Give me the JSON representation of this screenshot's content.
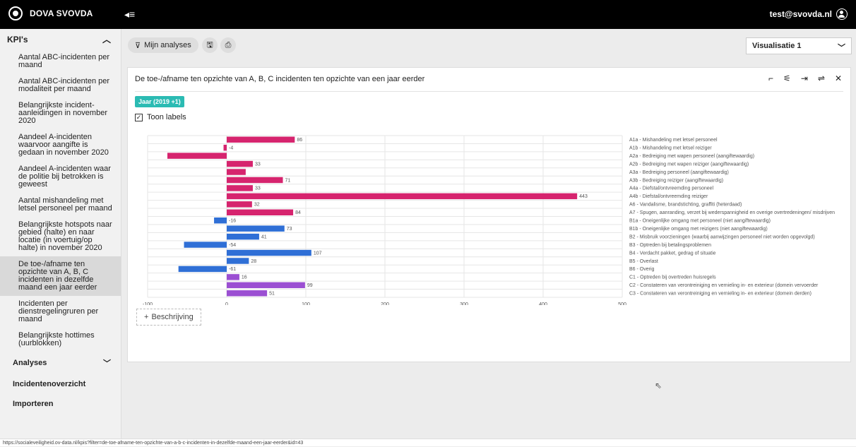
{
  "app": {
    "name": "DOVA SVOVDA",
    "menu_glyph": "◂≡"
  },
  "user": {
    "email": "test@svovda.nl"
  },
  "sidebar": {
    "kpis_label": "KPI's",
    "items": [
      {
        "label": "Aantal ABC-incidenten per maand",
        "active": false
      },
      {
        "label": "Aantal ABC-incidenten per modaliteit per maand",
        "active": false
      },
      {
        "label": "Belangrijkste incident-aanleidingen in november 2020",
        "active": false
      },
      {
        "label": "Aandeel A-incidenten waarvoor aangifte is gedaan in november 2020",
        "active": false
      },
      {
        "label": "Aandeel A-incidenten waar de politie bij betrokken is geweest",
        "active": false
      },
      {
        "label": "Aantal mishandeling met letsel personeel per maand",
        "active": false
      },
      {
        "label": "Belangrijkste hotspots naar gebied (halte) en naar locatie (in voertuig/op halte) in november 2020",
        "active": false
      },
      {
        "label": "De toe-/afname ten opzichte van A, B, C incidenten in dezelfde maand een jaar eerder",
        "active": true
      },
      {
        "label": "Incidenten per dienstregelingruren per maand",
        "active": false
      },
      {
        "label": "Belangrijkste hottimes (uurblokken)",
        "active": false
      }
    ],
    "analyses_label": "Analyses",
    "incidenten_label": "Incidentenoverzicht",
    "importeren_label": "Importeren"
  },
  "toolbar": {
    "analyses_label": "Mijn analyses",
    "save_glyph": "🖫",
    "print_glyph": "⎙",
    "visualisatie_value": "Visualisatie 1"
  },
  "card": {
    "title": "De toe-/afname ten opzichte van A, B, C incidenten ten opzichte van een jaar eerder",
    "filter_chip": "Jaar (2019 +1)",
    "toon_labels": "Toon labels",
    "toon_labels_checked": true,
    "beschrijving_label": "Beschrijving",
    "action_glyphs": [
      "⌐",
      "⚟",
      "⇥",
      "⇌",
      "✕"
    ]
  },
  "statusbar": {
    "url": "https://socialeveiligheid.ov-data.nl/kpis?filter=de-toe-afname-ten-opzichte-van-a-b-c-incidenten-in-dezelfde-maand-een-jaar-eerder&id=43"
  },
  "chart_data": {
    "type": "bar",
    "orientation": "horizontal",
    "xlim": [
      -100,
      500
    ],
    "xticks": [
      -100,
      0,
      100,
      200,
      300,
      400,
      500
    ],
    "grid": true,
    "categories": [
      "A1a - Mishandeling met letsel personeel",
      "A1b - Mishandeling met letsel reiziger",
      "A2a - Bedreiging met wapen personeel (aangiftewaardig)",
      "A2b - Bedreiging met wapen reiziger (aangiftewaardig)",
      "A3a - Bedreiging personeel (aangiftewaardig)",
      "A3b - Bedreiging reiziger (aangiftewaardig)",
      "A4a - Diefstal/ontvreemding personeel",
      "A4b - Diefstal/ontvreemding reiziger",
      "A6 - Vandalisme, brandstichting, graffiti (heterdaad)",
      "A7 - Spugen, aanranding, verzet bij wederspannigheid en overige overtredeningen/ misdrijven",
      "B1a - Oneigenlijke omgang met personeel (niet aangiftewaardig)",
      "B1b - Oneigenlijke omgang met reizigers (niet aangiftewaardig)",
      "B2 - Misbruik voorzieningen (waarbij aanwijzingen personeel niet worden opgevolgd)",
      "B3 - Optreden bij betalingsproblemen",
      "B4 - Verdacht pakket, gedrag of situatie",
      "B5 - Overlast",
      "B6 - Overig",
      "C1 - Optreden bij overtreden huisregels",
      "C2 - Constateren van verontreiniging en vernieling in- en exterieur (domein vervoerder",
      "C3 - Constateren van verontreiniging en vernieling in- en exterieur (domein derden)"
    ],
    "values": [
      86,
      -4,
      -75,
      33,
      24,
      71,
      33,
      443,
      32,
      84,
      -16,
      73,
      41,
      -54,
      107,
      28,
      -61,
      16,
      99,
      51
    ],
    "labels": [
      "86",
      "-4",
      "",
      "33",
      "",
      "71",
      "33",
      "443",
      "32",
      "84",
      "-16",
      "73",
      "41",
      "-54",
      "107",
      "28",
      "-61",
      "16",
      "99",
      "51"
    ],
    "groups": [
      "A",
      "A",
      "A",
      "A",
      "A",
      "A",
      "A",
      "A",
      "A",
      "A",
      "B",
      "B",
      "B",
      "B",
      "B",
      "B",
      "B",
      "C",
      "C",
      "C"
    ],
    "colors": {
      "A": "#d6246e",
      "B": "#2f6fd6",
      "C": "#9b4fd2"
    }
  }
}
